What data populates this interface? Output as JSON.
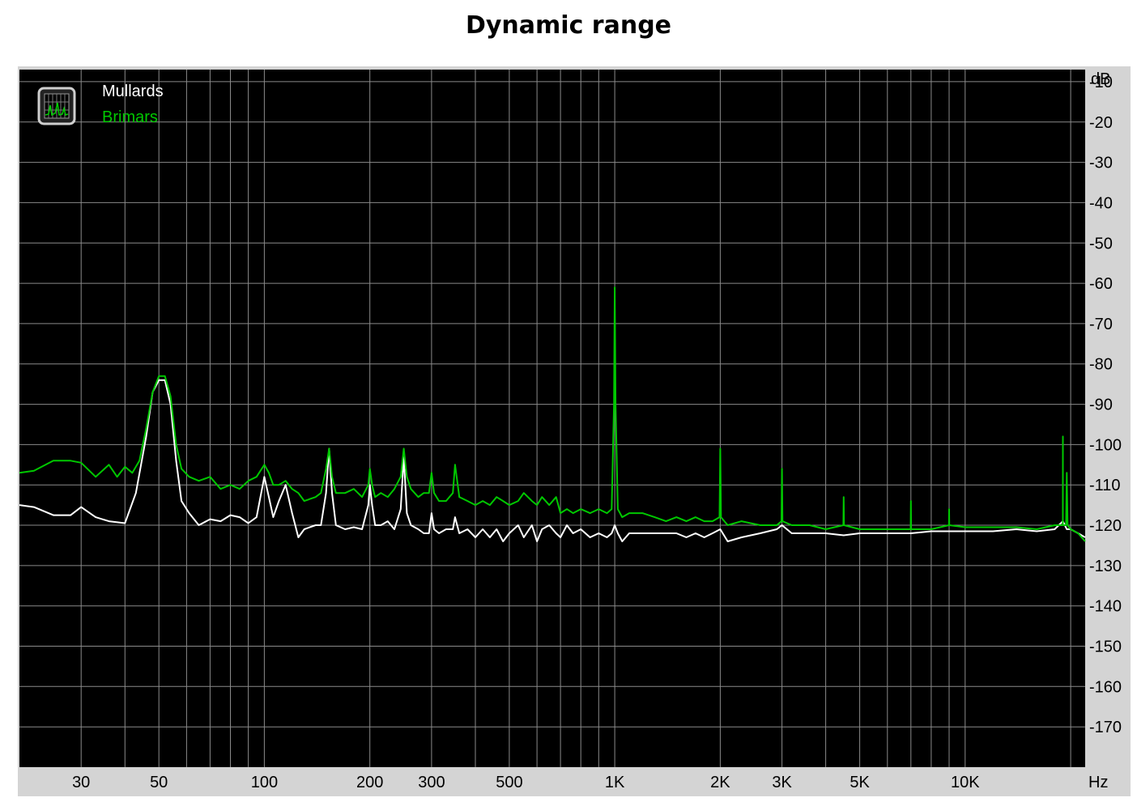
{
  "chart_data": {
    "type": "line",
    "title": "Dynamic range",
    "x_unit_label": "Hz",
    "y_unit_label": "dB",
    "x_scale": "log",
    "xlim": [
      20,
      22000
    ],
    "ylim": [
      -180,
      -7
    ],
    "grid": true,
    "legend_placement": "top-left",
    "x_ticks": [
      {
        "value": 30,
        "label": "30"
      },
      {
        "value": 50,
        "label": "50"
      },
      {
        "value": 100,
        "label": "100"
      },
      {
        "value": 200,
        "label": "200"
      },
      {
        "value": 300,
        "label": "300"
      },
      {
        "value": 500,
        "label": "500"
      },
      {
        "value": 1000,
        "label": "1K"
      },
      {
        "value": 2000,
        "label": "2K"
      },
      {
        "value": 3000,
        "label": "3K"
      },
      {
        "value": 5000,
        "label": "5K"
      },
      {
        "value": 10000,
        "label": "10K"
      }
    ],
    "y_ticks": [
      {
        "value": -10,
        "label": "-10"
      },
      {
        "value": -20,
        "label": "-20"
      },
      {
        "value": -30,
        "label": "-30"
      },
      {
        "value": -40,
        "label": "-40"
      },
      {
        "value": -50,
        "label": "-50"
      },
      {
        "value": -60,
        "label": "-60"
      },
      {
        "value": -70,
        "label": "-70"
      },
      {
        "value": -80,
        "label": "-80"
      },
      {
        "value": -90,
        "label": "-90"
      },
      {
        "value": -100,
        "label": "-100"
      },
      {
        "value": -110,
        "label": "-110"
      },
      {
        "value": -120,
        "label": "-120"
      },
      {
        "value": -130,
        "label": "-130"
      },
      {
        "value": -140,
        "label": "-140"
      },
      {
        "value": -150,
        "label": "-150"
      },
      {
        "value": -160,
        "label": "-160"
      },
      {
        "value": -170,
        "label": "-170"
      }
    ],
    "series": [
      {
        "name": "Mullards",
        "color": "#ffffff",
        "points": [
          [
            20,
            -115
          ],
          [
            22,
            -115.5
          ],
          [
            25,
            -117.5
          ],
          [
            28,
            -117.5
          ],
          [
            30,
            -115.5
          ],
          [
            33,
            -118
          ],
          [
            36,
            -119
          ],
          [
            40,
            -119.5
          ],
          [
            43,
            -112
          ],
          [
            46,
            -98
          ],
          [
            48,
            -87
          ],
          [
            50,
            -84
          ],
          [
            52,
            -84
          ],
          [
            54,
            -90
          ],
          [
            56,
            -104
          ],
          [
            58,
            -114
          ],
          [
            61,
            -117
          ],
          [
            65,
            -120
          ],
          [
            70,
            -118.5
          ],
          [
            75,
            -119
          ],
          [
            80,
            -117.5
          ],
          [
            85,
            -118
          ],
          [
            90,
            -119.5
          ],
          [
            95,
            -118
          ],
          [
            100,
            -108
          ],
          [
            103,
            -113
          ],
          [
            106,
            -118
          ],
          [
            110,
            -114
          ],
          [
            115,
            -110
          ],
          [
            120,
            -117
          ],
          [
            125,
            -123
          ],
          [
            130,
            -121
          ],
          [
            140,
            -120
          ],
          [
            145,
            -120
          ],
          [
            150,
            -112
          ],
          [
            153,
            -101
          ],
          [
            156,
            -112
          ],
          [
            160,
            -120
          ],
          [
            170,
            -121
          ],
          [
            180,
            -120.5
          ],
          [
            190,
            -121
          ],
          [
            198,
            -115
          ],
          [
            200,
            -110
          ],
          [
            203,
            -115
          ],
          [
            207,
            -120
          ],
          [
            215,
            -120
          ],
          [
            225,
            -119
          ],
          [
            235,
            -121
          ],
          [
            245,
            -116
          ],
          [
            250,
            -103
          ],
          [
            255,
            -117
          ],
          [
            262,
            -120
          ],
          [
            275,
            -121
          ],
          [
            285,
            -122
          ],
          [
            295,
            -122
          ],
          [
            300,
            -117
          ],
          [
            305,
            -121
          ],
          [
            315,
            -122
          ],
          [
            330,
            -121
          ],
          [
            345,
            -121
          ],
          [
            350,
            -118
          ],
          [
            360,
            -122
          ],
          [
            380,
            -121
          ],
          [
            400,
            -123
          ],
          [
            420,
            -121
          ],
          [
            440,
            -123
          ],
          [
            460,
            -121
          ],
          [
            480,
            -124
          ],
          [
            500,
            -122
          ],
          [
            530,
            -120
          ],
          [
            550,
            -123
          ],
          [
            580,
            -120
          ],
          [
            600,
            -124
          ],
          [
            620,
            -121
          ],
          [
            650,
            -120
          ],
          [
            680,
            -122
          ],
          [
            700,
            -123
          ],
          [
            730,
            -120
          ],
          [
            760,
            -122
          ],
          [
            800,
            -121
          ],
          [
            850,
            -123
          ],
          [
            900,
            -122
          ],
          [
            950,
            -123
          ],
          [
            980,
            -122
          ],
          [
            1000,
            -120
          ],
          [
            1020,
            -122
          ],
          [
            1050,
            -124
          ],
          [
            1100,
            -122
          ],
          [
            1200,
            -122
          ],
          [
            1300,
            -122
          ],
          [
            1400,
            -122
          ],
          [
            1500,
            -122
          ],
          [
            1600,
            -123
          ],
          [
            1700,
            -122
          ],
          [
            1800,
            -123
          ],
          [
            1900,
            -122
          ],
          [
            2000,
            -121
          ],
          [
            2100,
            -124
          ],
          [
            2300,
            -123
          ],
          [
            2600,
            -122
          ],
          [
            2900,
            -121
          ],
          [
            3000,
            -120
          ],
          [
            3200,
            -122
          ],
          [
            3600,
            -122
          ],
          [
            4000,
            -122
          ],
          [
            4500,
            -122.5
          ],
          [
            5000,
            -122
          ],
          [
            5500,
            -122
          ],
          [
            6000,
            -122
          ],
          [
            7000,
            -122
          ],
          [
            8000,
            -121.5
          ],
          [
            9000,
            -121.5
          ],
          [
            10000,
            -121.5
          ],
          [
            12000,
            -121.5
          ],
          [
            14000,
            -121
          ],
          [
            16000,
            -121.5
          ],
          [
            18000,
            -121
          ],
          [
            19000,
            -119
          ],
          [
            19500,
            -121
          ],
          [
            20000,
            -121
          ],
          [
            21000,
            -122
          ],
          [
            22000,
            -123
          ]
        ]
      },
      {
        "name": "Brimars",
        "color": "#00c800",
        "points": [
          [
            20,
            -107
          ],
          [
            22,
            -106.5
          ],
          [
            25,
            -104
          ],
          [
            28,
            -104
          ],
          [
            30,
            -104.5
          ],
          [
            33,
            -108
          ],
          [
            36,
            -105
          ],
          [
            38,
            -108
          ],
          [
            40,
            -105.5
          ],
          [
            42,
            -107
          ],
          [
            44,
            -104
          ],
          [
            46,
            -96
          ],
          [
            48,
            -87
          ],
          [
            50,
            -83
          ],
          [
            52,
            -83
          ],
          [
            54,
            -88
          ],
          [
            56,
            -100
          ],
          [
            58,
            -106
          ],
          [
            61,
            -108
          ],
          [
            65,
            -109
          ],
          [
            70,
            -108
          ],
          [
            75,
            -111
          ],
          [
            80,
            -110
          ],
          [
            85,
            -111
          ],
          [
            90,
            -109
          ],
          [
            95,
            -108
          ],
          [
            100,
            -105
          ],
          [
            103,
            -107
          ],
          [
            106,
            -110
          ],
          [
            110,
            -110
          ],
          [
            115,
            -109
          ],
          [
            120,
            -111
          ],
          [
            125,
            -112
          ],
          [
            130,
            -114
          ],
          [
            140,
            -113
          ],
          [
            145,
            -112
          ],
          [
            150,
            -106
          ],
          [
            153,
            -101
          ],
          [
            156,
            -108
          ],
          [
            160,
            -112
          ],
          [
            170,
            -112
          ],
          [
            180,
            -111
          ],
          [
            190,
            -113
          ],
          [
            198,
            -110
          ],
          [
            200,
            -106
          ],
          [
            203,
            -110
          ],
          [
            207,
            -113
          ],
          [
            215,
            -112
          ],
          [
            225,
            -113
          ],
          [
            235,
            -111
          ],
          [
            245,
            -108
          ],
          [
            250,
            -101
          ],
          [
            255,
            -108
          ],
          [
            262,
            -111
          ],
          [
            275,
            -113
          ],
          [
            285,
            -112
          ],
          [
            295,
            -112
          ],
          [
            300,
            -107
          ],
          [
            305,
            -112
          ],
          [
            315,
            -114
          ],
          [
            330,
            -114
          ],
          [
            345,
            -112
          ],
          [
            350,
            -105
          ],
          [
            360,
            -113
          ],
          [
            380,
            -114
          ],
          [
            400,
            -115
          ],
          [
            420,
            -114
          ],
          [
            440,
            -115
          ],
          [
            460,
            -113
          ],
          [
            480,
            -114
          ],
          [
            500,
            -115
          ],
          [
            530,
            -114
          ],
          [
            550,
            -112
          ],
          [
            580,
            -114
          ],
          [
            600,
            -115
          ],
          [
            620,
            -113
          ],
          [
            650,
            -115
          ],
          [
            680,
            -113
          ],
          [
            700,
            -117
          ],
          [
            730,
            -116
          ],
          [
            760,
            -117
          ],
          [
            800,
            -116
          ],
          [
            850,
            -117
          ],
          [
            900,
            -116
          ],
          [
            950,
            -117
          ],
          [
            980,
            -116
          ],
          [
            995,
            -90
          ],
          [
            1000,
            -61
          ],
          [
            1005,
            -90
          ],
          [
            1020,
            -116
          ],
          [
            1050,
            -118
          ],
          [
            1100,
            -117
          ],
          [
            1200,
            -117
          ],
          [
            1300,
            -118
          ],
          [
            1400,
            -119
          ],
          [
            1500,
            -118
          ],
          [
            1600,
            -119
          ],
          [
            1700,
            -118
          ],
          [
            1800,
            -119
          ],
          [
            1900,
            -119
          ],
          [
            1990,
            -118
          ],
          [
            2000,
            -101
          ],
          [
            2010,
            -118
          ],
          [
            2100,
            -120
          ],
          [
            2300,
            -119
          ],
          [
            2600,
            -120
          ],
          [
            2900,
            -120
          ],
          [
            2990,
            -119
          ],
          [
            3000,
            -106
          ],
          [
            3010,
            -119
          ],
          [
            3200,
            -120
          ],
          [
            3600,
            -120
          ],
          [
            4000,
            -121
          ],
          [
            4490,
            -120
          ],
          [
            4500,
            -113
          ],
          [
            4510,
            -120
          ],
          [
            5000,
            -121
          ],
          [
            5500,
            -121
          ],
          [
            6000,
            -121
          ],
          [
            6990,
            -121
          ],
          [
            7000,
            -114
          ],
          [
            7010,
            -121
          ],
          [
            8000,
            -121
          ],
          [
            8990,
            -120
          ],
          [
            9000,
            -116
          ],
          [
            9010,
            -120
          ],
          [
            10000,
            -120.5
          ],
          [
            12000,
            -120.5
          ],
          [
            14000,
            -120.5
          ],
          [
            16000,
            -121
          ],
          [
            18000,
            -120
          ],
          [
            18990,
            -120
          ],
          [
            19000,
            -98
          ],
          [
            19010,
            -120
          ],
          [
            19400,
            -120
          ],
          [
            19500,
            -107
          ],
          [
            19600,
            -120
          ],
          [
            20000,
            -121
          ],
          [
            21000,
            -122
          ],
          [
            22000,
            -124
          ]
        ]
      }
    ]
  }
}
